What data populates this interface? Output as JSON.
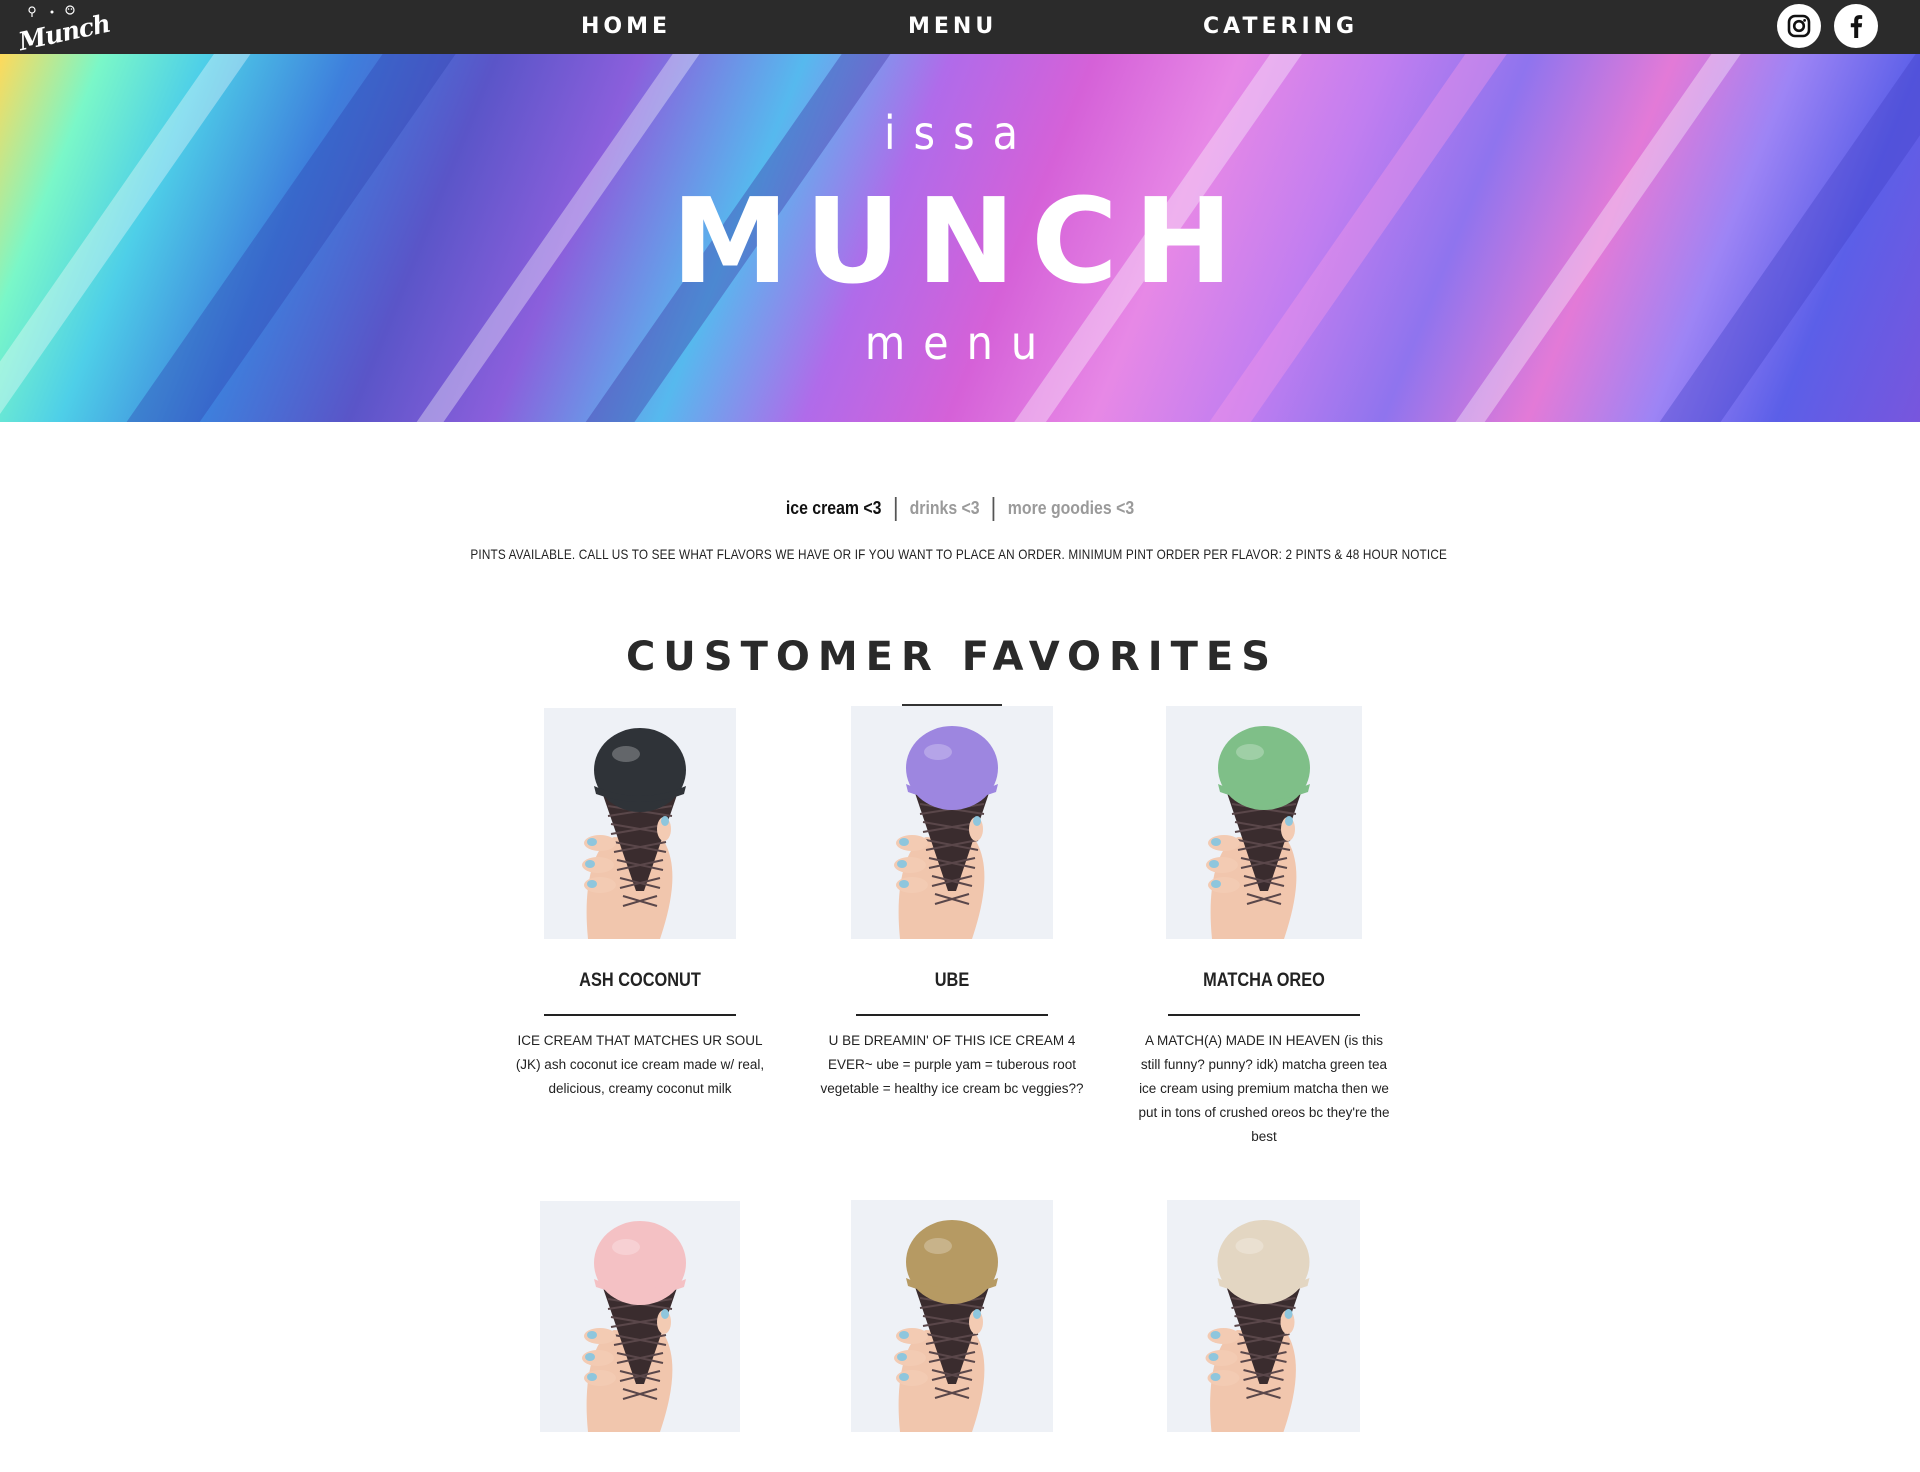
{
  "nav": {
    "logo_text": "Munch",
    "items": [
      {
        "label": "HOME"
      },
      {
        "label": "MENU"
      },
      {
        "label": "CATERING"
      }
    ],
    "social": [
      {
        "icon": "instagram-icon"
      },
      {
        "icon": "facebook-icon"
      }
    ]
  },
  "hero": {
    "line1": "issa",
    "line2": "MUNCH",
    "line3": "menu"
  },
  "tabs": [
    {
      "label": "ice cream <3",
      "active": true
    },
    {
      "label": "drinks <3",
      "active": false
    },
    {
      "label": "more goodies <3",
      "active": false
    }
  ],
  "notice": "PINTS AVAILABLE. CALL US TO SEE WHAT FLAVORS WE HAVE OR IF YOU WANT TO PLACE AN ORDER. MINIMUM PINT ORDER PER FLAVOR: 2 PINTS & 48 HOUR NOTICE",
  "section_title": "CUSTOMER FAVORITES",
  "products": [
    {
      "name": "ASH COCONUT",
      "description": "ICE CREAM THAT MATCHES UR SOUL (JK) ash coconut ice cream made w/ real, delicious, creamy coconut milk",
      "scoop_color": "#2f3338"
    },
    {
      "name": "UBE",
      "description": "U BE DREAMIN' OF THIS ICE CREAM 4 EVER~ ube = purple yam = tuberous root vegetable = healthy ice cream bc veggies??",
      "scoop_color": "#9d86e0"
    },
    {
      "name": "MATCHA OREO",
      "description": "A MATCH(A) MADE IN HEAVEN (is this still funny? punny? idk) matcha green tea ice cream using premium matcha then we put in tons of crushed oreos bc they're the best",
      "scoop_color": "#7fbf88"
    },
    {
      "name": "",
      "description": "",
      "scoop_color": "#f4c1c4"
    },
    {
      "name": "",
      "description": "",
      "scoop_color": "#b69a63"
    },
    {
      "name": "",
      "description": "",
      "scoop_color": "#e3d6c2"
    }
  ],
  "colors": {
    "nav_bg": "#2b2b2b",
    "text_dark": "#222222",
    "tab_inactive": "#9a9a9a"
  }
}
